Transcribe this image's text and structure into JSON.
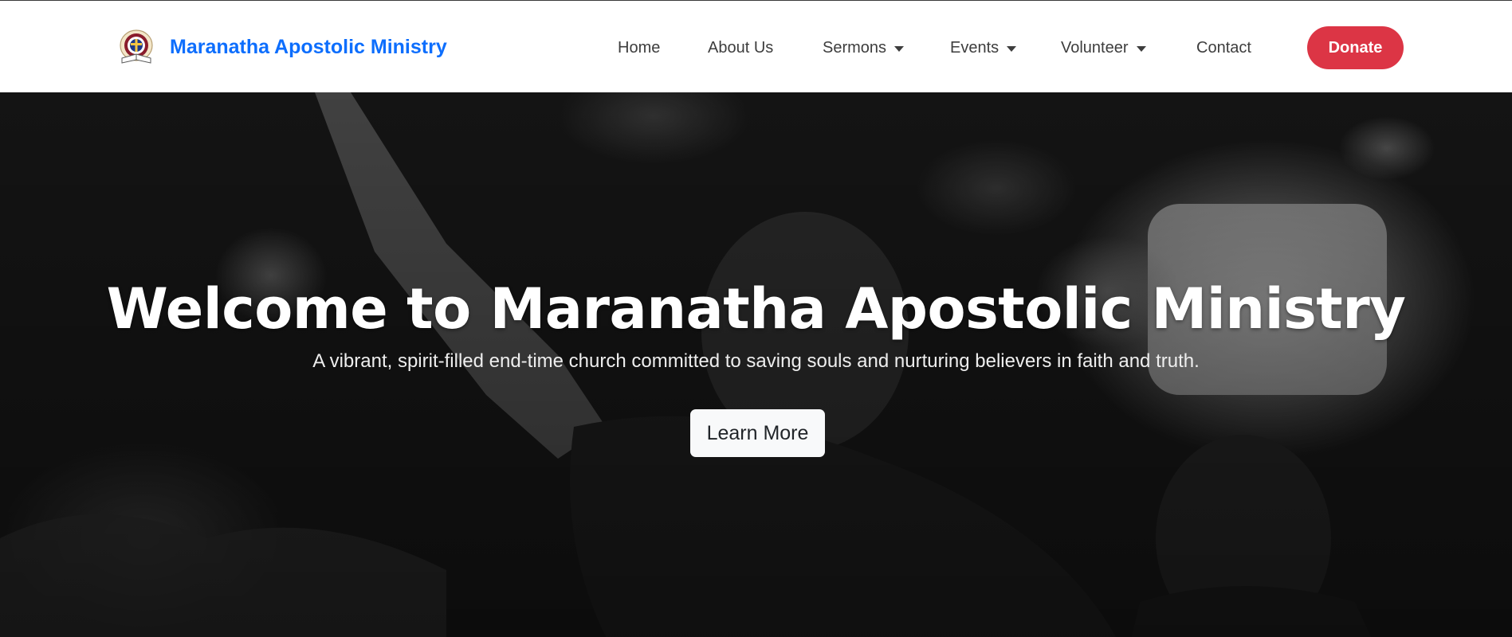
{
  "navbar": {
    "brand_name": "Maranatha Apostolic Ministry",
    "logo_icon": "church-seal-logo",
    "items": [
      {
        "label": "Home",
        "dropdown": false
      },
      {
        "label": "About Us",
        "dropdown": false
      },
      {
        "label": "Sermons",
        "dropdown": true
      },
      {
        "label": "Events",
        "dropdown": true
      },
      {
        "label": "Volunteer",
        "dropdown": true
      },
      {
        "label": "Contact",
        "dropdown": false
      }
    ],
    "donate_label": "Donate"
  },
  "hero": {
    "title": "Welcome to Maranatha Apostolic Ministry",
    "subtitle": "A vibrant, spirit-filled end-time church committed to saving souls and nurturing believers in faith and truth.",
    "cta_label": "Learn More",
    "background": "grayscale-worship-photo"
  },
  "colors": {
    "brand": "#0d6efd",
    "donate": "#dc3545",
    "nav_text": "#3d3d3d",
    "hero_overlay": "#0e0e0e",
    "cta_bg": "#f8f9fa"
  }
}
